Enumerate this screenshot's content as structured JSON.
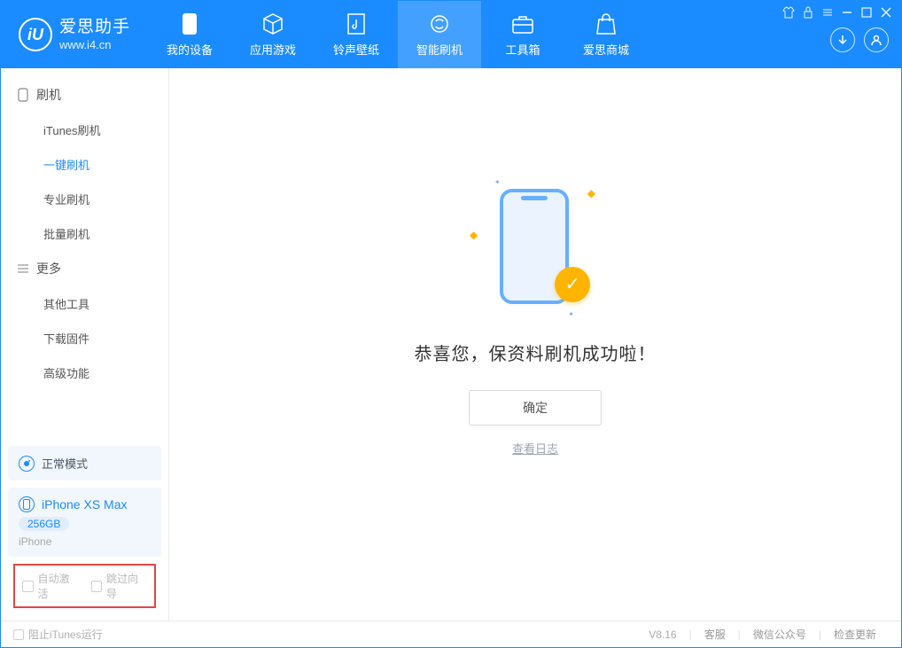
{
  "app": {
    "name_cn": "爱思助手",
    "url": "www.i4.cn",
    "logo_letter": "iU"
  },
  "tabs": [
    {
      "label": "我的设备"
    },
    {
      "label": "应用游戏"
    },
    {
      "label": "铃声壁纸"
    },
    {
      "label": "智能刷机"
    },
    {
      "label": "工具箱"
    },
    {
      "label": "爱思商城"
    }
  ],
  "sidebar": {
    "groups": [
      {
        "title": "刷机",
        "items": [
          {
            "label": "iTunes刷机"
          },
          {
            "label": "一键刷机",
            "active": true
          },
          {
            "label": "专业刷机"
          },
          {
            "label": "批量刷机"
          }
        ]
      },
      {
        "title": "更多",
        "items": [
          {
            "label": "其他工具"
          },
          {
            "label": "下载固件"
          },
          {
            "label": "高级功能"
          }
        ]
      }
    ],
    "mode_card": "正常模式",
    "device": {
      "name": "iPhone XS Max",
      "storage": "256GB",
      "type": "iPhone"
    },
    "options": {
      "auto_activate": "自动激活",
      "skip_guide": "跳过向导"
    }
  },
  "main": {
    "success_message": "恭喜您，保资料刷机成功啦！",
    "ok_button": "确定",
    "view_log": "查看日志"
  },
  "footer": {
    "prevent_itunes": "阻止iTunes运行",
    "version": "V8.16",
    "links": [
      {
        "label": "客服"
      },
      {
        "label": "微信公众号"
      },
      {
        "label": "检查更新"
      }
    ]
  }
}
